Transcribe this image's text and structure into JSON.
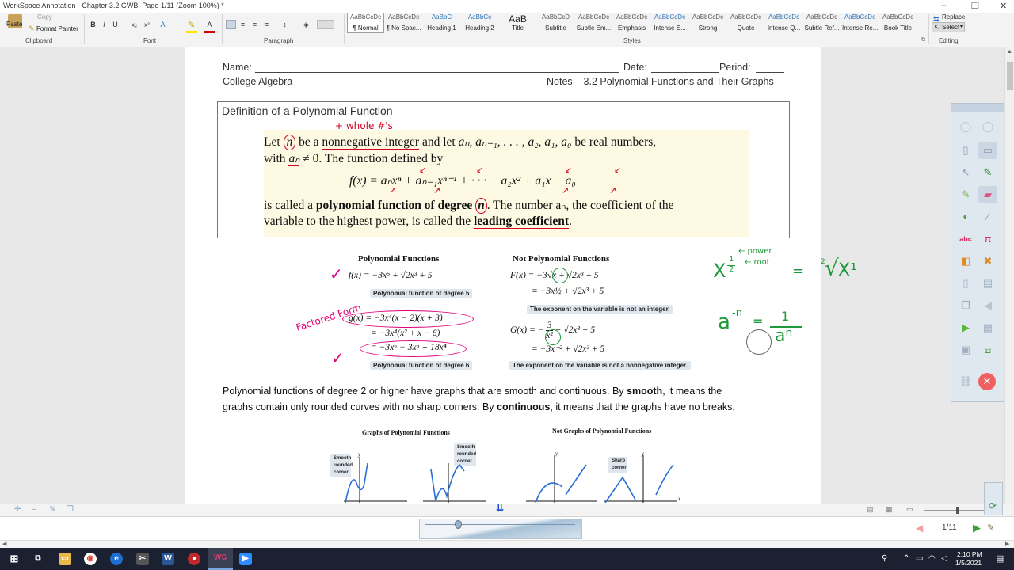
{
  "window": {
    "title": "WorkSpace Annotation - Chapter 3.2.GWB, Page 1/11  (Zoom 100%) *",
    "controls": [
      "–",
      "❐",
      "✕"
    ]
  },
  "ribbon": {
    "clipboard": {
      "paste": "Paste",
      "copy": "Copy",
      "format_painter": "Format Painter",
      "label": "Clipboard"
    },
    "font": {
      "label": "Font",
      "tools": [
        "B",
        "I",
        "U",
        "x₂",
        "x²",
        "A"
      ]
    },
    "paragraph": {
      "label": "Paragraph"
    },
    "styles": {
      "label": "Styles",
      "items": [
        {
          "name": "¶ Normal",
          "sample": "AaBbCcDc"
        },
        {
          "name": "¶ No Spac...",
          "sample": "AaBbCcDc"
        },
        {
          "name": "Heading 1",
          "sample": "AaBbC"
        },
        {
          "name": "Heading 2",
          "sample": "AaBbCc"
        },
        {
          "name": "Title",
          "sample": "AaB"
        },
        {
          "name": "Subtitle",
          "sample": "AaBbCcD"
        },
        {
          "name": "Subtle Em...",
          "sample": "AaBbCcDc"
        },
        {
          "name": "Emphasis",
          "sample": "AaBbCcDc"
        },
        {
          "name": "Intense E...",
          "sample": "AaBbCcDc"
        },
        {
          "name": "Strong",
          "sample": "AaBbCcDc"
        },
        {
          "name": "Quote",
          "sample": "AaBbCcDc"
        },
        {
          "name": "Intense Q...",
          "sample": "AaBbCcDc"
        },
        {
          "name": "Subtle Ref...",
          "sample": "AaBbCcDc"
        },
        {
          "name": "Intense Re...",
          "sample": "AaBbCcDc"
        },
        {
          "name": "Book Title",
          "sample": "AaBbCcDc"
        }
      ]
    },
    "editing": {
      "label": "Editing",
      "replace": "Replace",
      "select": "Select"
    }
  },
  "document": {
    "header": {
      "name_label": "Name:",
      "date_label": "Date:",
      "period_label": "Period:",
      "course": "College Algebra",
      "notes_title": "Notes – 3.2 Polynomial Functions and Their Graphs"
    },
    "definition": {
      "heading": "Definition of a Polynomial Function",
      "line1_a": "Let",
      "line1_n": "n",
      "line1_b": "be a",
      "line1_c": "nonnegative integer",
      "line1_d": "and let",
      "line1_coeffs": "aₙ, aₙ₋₁, . . . , a₂, a₁, a₀",
      "line1_e": "be real numbers,",
      "line2_a": "with",
      "line2_an": "aₙ",
      "line2_b": "≠ 0. The function defined by",
      "formula_f": "f(x) =",
      "formula_terms": "aₙxⁿ + aₙ₋₁xⁿ⁻¹ + · · · + a₂x² + a₁x + a₀",
      "line4_a": "is called a",
      "line4_b": "polynomial function of degree",
      "line4_n": "n",
      "line4_c": ". The number aₙ, the coefficient of the",
      "line5_a": "variable to the highest power, is called the",
      "line5_b": "leading coefficient",
      "line5_c": ".",
      "annot_whole": "+ whole #'s"
    },
    "examples": {
      "poly_heading": "Polynomial Functions",
      "not_poly_heading": "Not Polynomial Functions",
      "f_eq": "f(x) = −3x⁵ + √2x³ + 5",
      "f_note": "Polynomial function of degree 5",
      "g_eq1": "g(x) = −3x⁴(x − 2)(x + 3)",
      "g_eq2": "= −3x⁴(x² + x − 6)",
      "g_eq3": "= −3x⁶ − 3x⁵ + 18x⁴",
      "g_note": "Polynomial function of degree 6",
      "F_eq1": "F(x) = −3√x + √2x³ + 5",
      "F_eq2": "= −3x½ + √2x³ + 5",
      "F_note": "The exponent on the variable is not an integer.",
      "G_eq1_a": "G(x) = −",
      "G_eq1_frac_num": "3",
      "G_eq1_frac_den": "x²",
      "G_eq1_b": "+ √2x³ + 5",
      "G_eq2": "= −3x⁻² + √2x³ + 5",
      "G_note": "The exponent on the variable is not a nonnegative integer.",
      "annot_factored": "Factored Form",
      "annot_check": "✓"
    },
    "side_notes": {
      "x_base": "X",
      "x_exp_num": "1",
      "x_exp_den": "2",
      "power_label": "← power",
      "root_label": "← root",
      "equals": "=",
      "root_index": "2",
      "radical_sign": "√",
      "radicand": "X¹",
      "a_base": "a",
      "a_exp": "-n",
      "one": "1",
      "a_den": "aⁿ"
    },
    "paragraph": {
      "p1": "Polynomial functions of degree 2 or higher have graphs that are smooth and continuous. By ",
      "smooth": "smooth",
      "p2": ", it means the",
      "p3": "graphs contain only rounded curves with no sharp corners. By ",
      "continuous": "continuous",
      "p4": ", it means that the graphs have no breaks."
    },
    "graphs": {
      "poly_title": "Graphs of Polynomial Functions",
      "not_poly_title": "Not Graphs of Polynomial Functions",
      "smooth_callout_1": "Smooth rounded corner",
      "smooth_callout_2": "Smooth rounded corner",
      "sharp_callout": "Sharp corner",
      "y_axis": "y",
      "x_axis": "x"
    }
  },
  "statusbar": {
    "page_indicator": "1/11"
  },
  "taskbar": {
    "time": "2:10 PM",
    "date": "1/5/2021"
  },
  "colors": {
    "ink_red": "#d40020",
    "ink_magenta": "#e0007a",
    "ink_green": "#1e9a3a",
    "highlight": "#fdf9e3"
  }
}
